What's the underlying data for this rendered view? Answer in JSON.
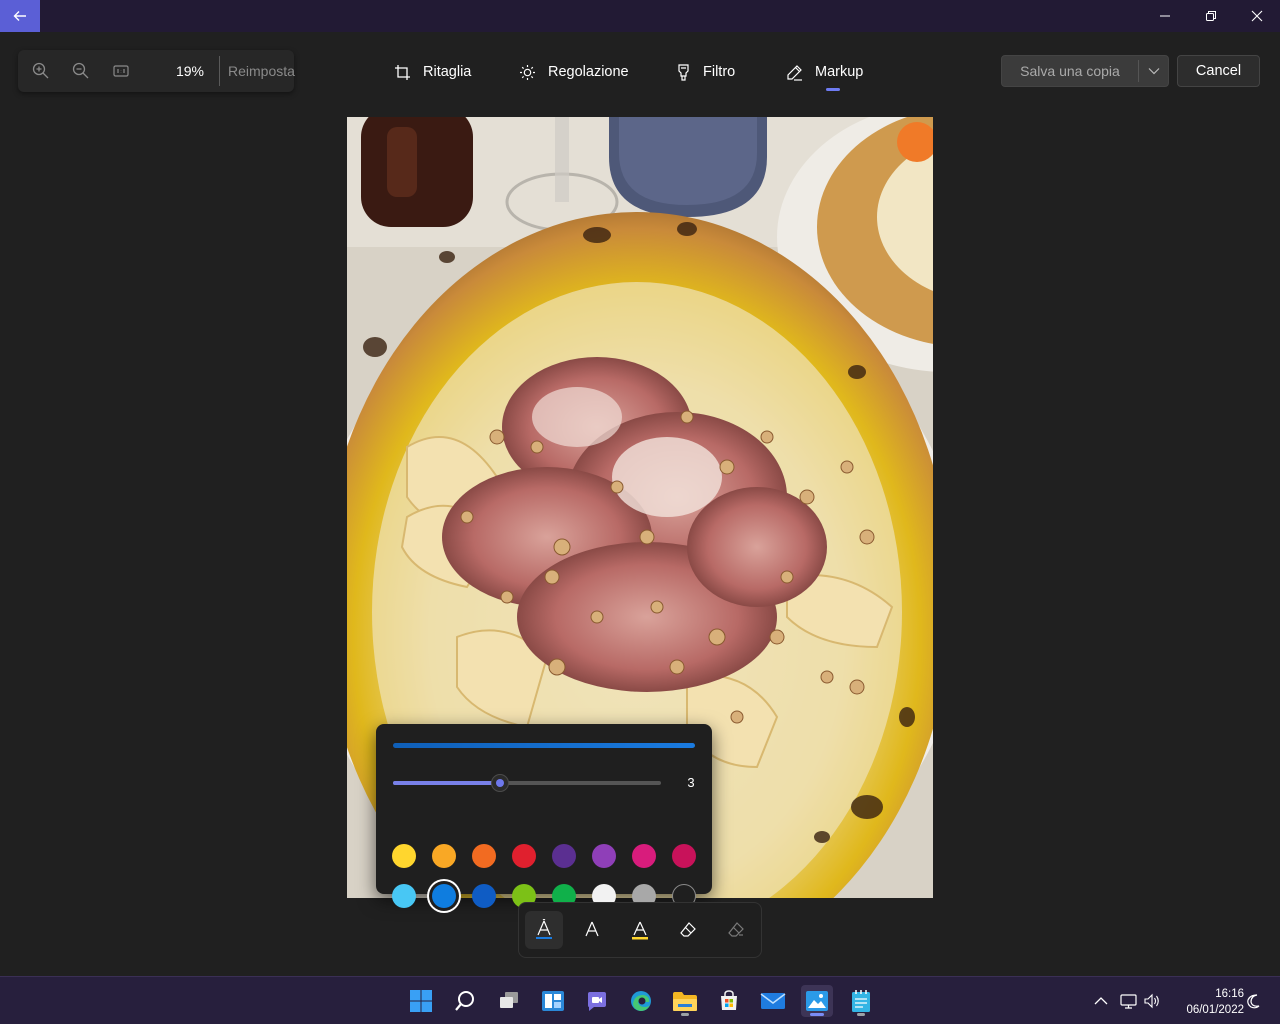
{
  "zoom": {
    "percent": "19%",
    "reset_label": "Reimposta"
  },
  "tools": {
    "crop": "Ritaglia",
    "adjust": "Regolazione",
    "filter": "Filtro",
    "markup": "Markup"
  },
  "actions": {
    "save_copy": "Salva una copia",
    "cancel": "Cancel"
  },
  "pen_popup": {
    "size_value": "3",
    "size_fraction": 0.4,
    "selected_color": "#0f7ddf",
    "colors_row1": [
      "#ffd62e",
      "#f9a825",
      "#f26b21",
      "#e0202e",
      "#5b2f91",
      "#8f3fb8",
      "#d81c7c",
      "#c8125a"
    ],
    "colors_row2": [
      "#48c7f4",
      "#0f7ddf",
      "#0f5cc4",
      "#7cc117",
      "#10b04a",
      "#f2f2f2",
      "#a8a8a8",
      "#1f1f1f"
    ]
  },
  "markup_tools": [
    "ballpoint-pen",
    "calligraphy-pen",
    "highlighter",
    "eraser",
    "clear-all"
  ],
  "taskbar": {
    "apps": [
      "start",
      "search",
      "task-view",
      "widgets",
      "teams-chat",
      "edge",
      "file-explorer",
      "microsoft-store",
      "mail",
      "photos",
      "notepad"
    ],
    "time": "16:16",
    "date": "06/01/2022"
  },
  "colors": {
    "accent": "#6e7bf2",
    "titlebar": "#221a34",
    "taskbar": "#271f3d"
  }
}
